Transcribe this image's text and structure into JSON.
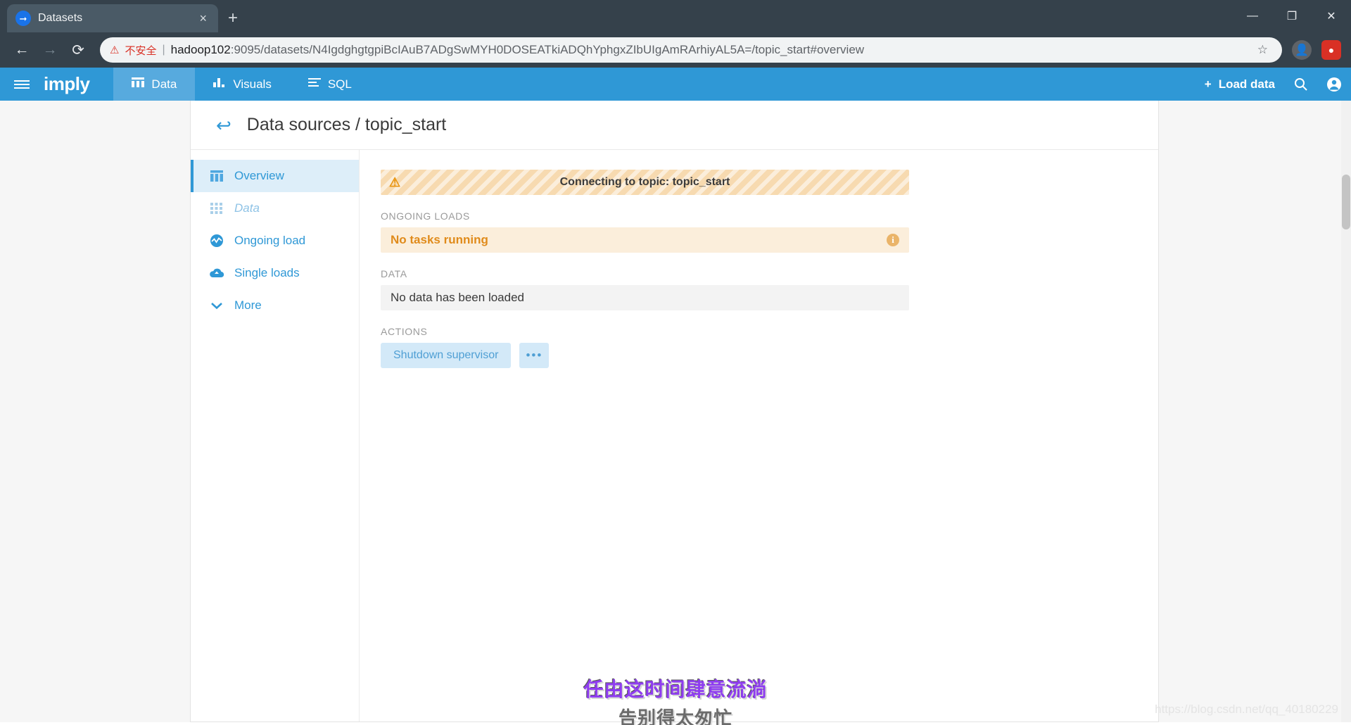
{
  "browser": {
    "tab": {
      "title": "Datasets",
      "favicon": "arrow-right-circle-icon",
      "close": "×"
    },
    "new_tab": "+",
    "window_controls": {
      "minimize": "—",
      "maximize": "❐",
      "close": "✕"
    },
    "nav": {
      "back": "←",
      "forward": "→",
      "reload": "⟳"
    },
    "omnibox": {
      "warning_icon": "⚠",
      "security_label": "不安全",
      "separator": "|",
      "host": "hadoop102",
      "path": ":9095/datasets/N4IgdghgtgpiBcIAuB7ADgSwMYH0DOSEATkiADQhYphgxZIbUIgAmRArhiyAL5A=/topic_start#overview",
      "bookmark_icon": "☆",
      "profile_icon": "•",
      "extension_icon": "♥"
    }
  },
  "appbar": {
    "menu_icon": "hamburger-icon",
    "brand": "imply",
    "items": [
      {
        "label": "Data",
        "icon": "bar-chart-icon",
        "active": true
      },
      {
        "label": "Visuals",
        "icon": "chart-icon",
        "active": false
      },
      {
        "label": "SQL",
        "icon": "list-icon",
        "active": false
      }
    ],
    "load_data": {
      "plus": "+",
      "label": "Load data"
    },
    "search_icon": "⌕",
    "account_icon": "account-icon"
  },
  "page": {
    "back_arrow": "↩",
    "title": "Data sources / topic_start"
  },
  "sidebar": {
    "items": [
      {
        "label": "Overview",
        "icon": "columns-icon",
        "state": "active"
      },
      {
        "label": "Data",
        "icon": "grid-icon",
        "state": "disabled"
      },
      {
        "label": "Ongoing load",
        "icon": "pulse-cloud-icon",
        "state": "normal"
      },
      {
        "label": "Single loads",
        "icon": "cloud-icon",
        "state": "normal"
      },
      {
        "label": "More",
        "icon": "chevron-down-icon",
        "state": "normal"
      }
    ]
  },
  "main": {
    "banner": {
      "icon": "warning-triangle-icon",
      "text": "Connecting to topic: topic_start"
    },
    "ongoing_loads": {
      "label": "ONGOING LOADS",
      "status": "No tasks running",
      "info_icon": "i"
    },
    "data": {
      "label": "DATA",
      "message": "No data has been loaded"
    },
    "actions": {
      "label": "ACTIONS",
      "primary": "Shutdown supervisor",
      "more": "•••"
    }
  },
  "watermark": {
    "line1": "任由这时间肆意流淌",
    "line2": "告别得太匆忙",
    "corner": "https://blog.csdn.net/qq_40180229"
  },
  "colors": {
    "brand_blue": "#2f98d6",
    "warning_orange": "#e08b1b",
    "banner_bg": "#f7dab0",
    "insecure_red": "#d93025"
  }
}
